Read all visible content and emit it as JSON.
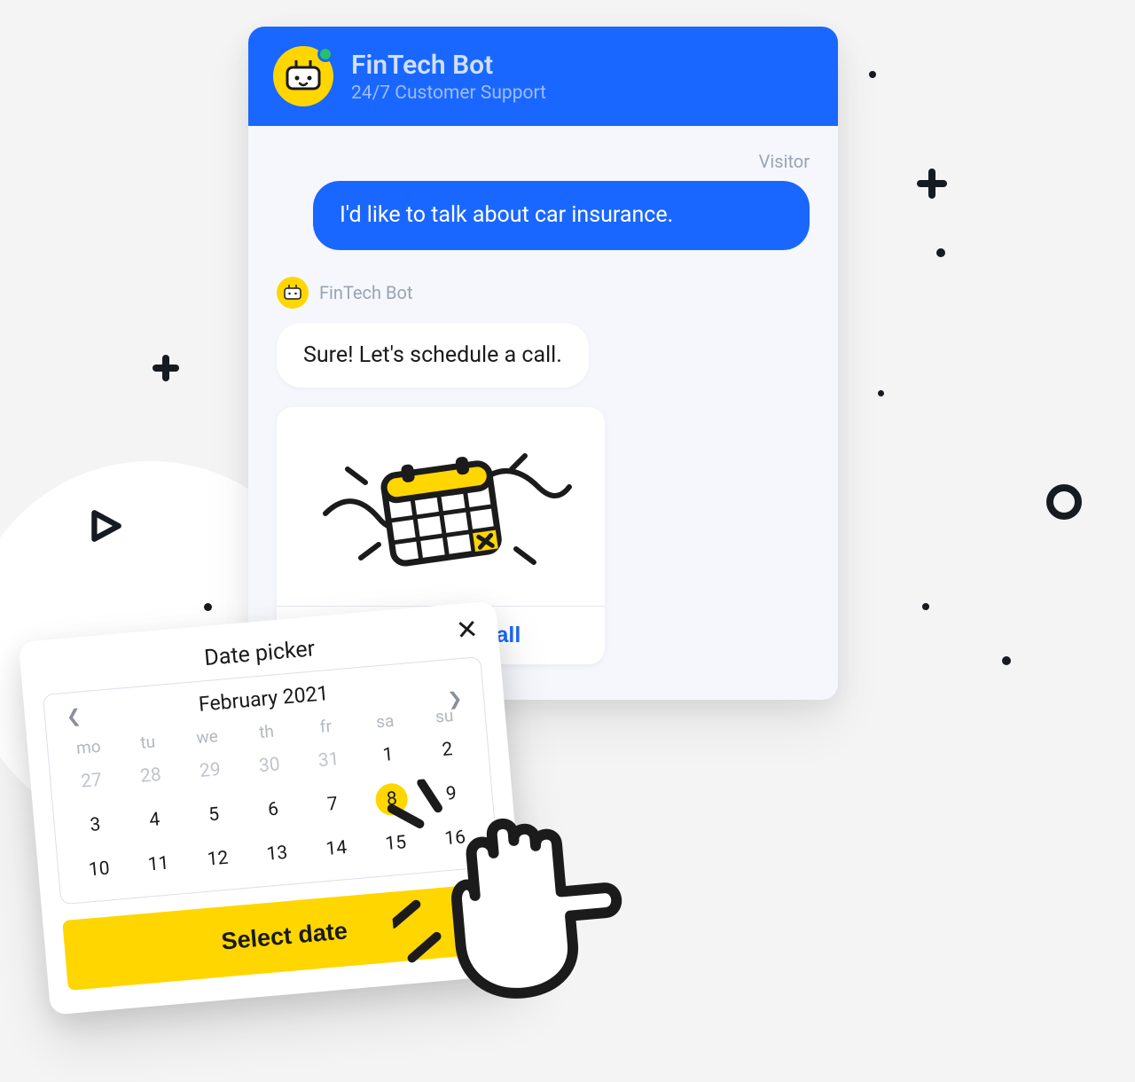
{
  "header": {
    "title": "FinTech Bot",
    "subtitle": "24/7 Customer Support"
  },
  "visitor": {
    "label": "Visitor",
    "message": "I'd like to talk about car insurance."
  },
  "bot": {
    "name": "FinTech Bot",
    "message": "Sure! Let's schedule a call."
  },
  "card": {
    "action": "Schedule a call"
  },
  "picker": {
    "title": "Date picker",
    "month": "February 2021",
    "days_of_week": [
      "mo",
      "tu",
      "we",
      "th",
      "fr",
      "sa",
      "su"
    ],
    "selected": "8",
    "select_label": "Select date",
    "rows": [
      [
        {
          "n": "27",
          "muted": true
        },
        {
          "n": "28",
          "muted": true
        },
        {
          "n": "29",
          "muted": true
        },
        {
          "n": "30",
          "muted": true
        },
        {
          "n": "31",
          "muted": true
        },
        {
          "n": "1"
        },
        {
          "n": "2"
        }
      ],
      [
        {
          "n": "3"
        },
        {
          "n": "4"
        },
        {
          "n": "5"
        },
        {
          "n": "6"
        },
        {
          "n": "7"
        },
        {
          "n": "8",
          "sel": true
        },
        {
          "n": "9"
        }
      ],
      [
        {
          "n": "10"
        },
        {
          "n": "11"
        },
        {
          "n": "12"
        },
        {
          "n": "13"
        },
        {
          "n": "14"
        },
        {
          "n": "15"
        },
        {
          "n": "16"
        }
      ]
    ]
  }
}
